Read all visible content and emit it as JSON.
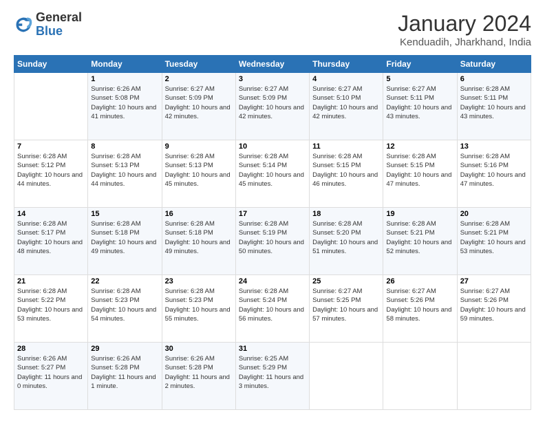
{
  "logo": {
    "line1": "General",
    "line2": "Blue"
  },
  "title": "January 2024",
  "subtitle": "Kenduadih, Jharkhand, India",
  "headers": [
    "Sunday",
    "Monday",
    "Tuesday",
    "Wednesday",
    "Thursday",
    "Friday",
    "Saturday"
  ],
  "weeks": [
    [
      {
        "day": "",
        "sunrise": "",
        "sunset": "",
        "daylight": ""
      },
      {
        "day": "1",
        "sunrise": "Sunrise: 6:26 AM",
        "sunset": "Sunset: 5:08 PM",
        "daylight": "Daylight: 10 hours and 41 minutes."
      },
      {
        "day": "2",
        "sunrise": "Sunrise: 6:27 AM",
        "sunset": "Sunset: 5:09 PM",
        "daylight": "Daylight: 10 hours and 42 minutes."
      },
      {
        "day": "3",
        "sunrise": "Sunrise: 6:27 AM",
        "sunset": "Sunset: 5:09 PM",
        "daylight": "Daylight: 10 hours and 42 minutes."
      },
      {
        "day": "4",
        "sunrise": "Sunrise: 6:27 AM",
        "sunset": "Sunset: 5:10 PM",
        "daylight": "Daylight: 10 hours and 42 minutes."
      },
      {
        "day": "5",
        "sunrise": "Sunrise: 6:27 AM",
        "sunset": "Sunset: 5:11 PM",
        "daylight": "Daylight: 10 hours and 43 minutes."
      },
      {
        "day": "6",
        "sunrise": "Sunrise: 6:28 AM",
        "sunset": "Sunset: 5:11 PM",
        "daylight": "Daylight: 10 hours and 43 minutes."
      }
    ],
    [
      {
        "day": "7",
        "sunrise": "Sunrise: 6:28 AM",
        "sunset": "Sunset: 5:12 PM",
        "daylight": "Daylight: 10 hours and 44 minutes."
      },
      {
        "day": "8",
        "sunrise": "Sunrise: 6:28 AM",
        "sunset": "Sunset: 5:13 PM",
        "daylight": "Daylight: 10 hours and 44 minutes."
      },
      {
        "day": "9",
        "sunrise": "Sunrise: 6:28 AM",
        "sunset": "Sunset: 5:13 PM",
        "daylight": "Daylight: 10 hours and 45 minutes."
      },
      {
        "day": "10",
        "sunrise": "Sunrise: 6:28 AM",
        "sunset": "Sunset: 5:14 PM",
        "daylight": "Daylight: 10 hours and 45 minutes."
      },
      {
        "day": "11",
        "sunrise": "Sunrise: 6:28 AM",
        "sunset": "Sunset: 5:15 PM",
        "daylight": "Daylight: 10 hours and 46 minutes."
      },
      {
        "day": "12",
        "sunrise": "Sunrise: 6:28 AM",
        "sunset": "Sunset: 5:15 PM",
        "daylight": "Daylight: 10 hours and 47 minutes."
      },
      {
        "day": "13",
        "sunrise": "Sunrise: 6:28 AM",
        "sunset": "Sunset: 5:16 PM",
        "daylight": "Daylight: 10 hours and 47 minutes."
      }
    ],
    [
      {
        "day": "14",
        "sunrise": "Sunrise: 6:28 AM",
        "sunset": "Sunset: 5:17 PM",
        "daylight": "Daylight: 10 hours and 48 minutes."
      },
      {
        "day": "15",
        "sunrise": "Sunrise: 6:28 AM",
        "sunset": "Sunset: 5:18 PM",
        "daylight": "Daylight: 10 hours and 49 minutes."
      },
      {
        "day": "16",
        "sunrise": "Sunrise: 6:28 AM",
        "sunset": "Sunset: 5:18 PM",
        "daylight": "Daylight: 10 hours and 49 minutes."
      },
      {
        "day": "17",
        "sunrise": "Sunrise: 6:28 AM",
        "sunset": "Sunset: 5:19 PM",
        "daylight": "Daylight: 10 hours and 50 minutes."
      },
      {
        "day": "18",
        "sunrise": "Sunrise: 6:28 AM",
        "sunset": "Sunset: 5:20 PM",
        "daylight": "Daylight: 10 hours and 51 minutes."
      },
      {
        "day": "19",
        "sunrise": "Sunrise: 6:28 AM",
        "sunset": "Sunset: 5:21 PM",
        "daylight": "Daylight: 10 hours and 52 minutes."
      },
      {
        "day": "20",
        "sunrise": "Sunrise: 6:28 AM",
        "sunset": "Sunset: 5:21 PM",
        "daylight": "Daylight: 10 hours and 53 minutes."
      }
    ],
    [
      {
        "day": "21",
        "sunrise": "Sunrise: 6:28 AM",
        "sunset": "Sunset: 5:22 PM",
        "daylight": "Daylight: 10 hours and 53 minutes."
      },
      {
        "day": "22",
        "sunrise": "Sunrise: 6:28 AM",
        "sunset": "Sunset: 5:23 PM",
        "daylight": "Daylight: 10 hours and 54 minutes."
      },
      {
        "day": "23",
        "sunrise": "Sunrise: 6:28 AM",
        "sunset": "Sunset: 5:23 PM",
        "daylight": "Daylight: 10 hours and 55 minutes."
      },
      {
        "day": "24",
        "sunrise": "Sunrise: 6:28 AM",
        "sunset": "Sunset: 5:24 PM",
        "daylight": "Daylight: 10 hours and 56 minutes."
      },
      {
        "day": "25",
        "sunrise": "Sunrise: 6:27 AM",
        "sunset": "Sunset: 5:25 PM",
        "daylight": "Daylight: 10 hours and 57 minutes."
      },
      {
        "day": "26",
        "sunrise": "Sunrise: 6:27 AM",
        "sunset": "Sunset: 5:26 PM",
        "daylight": "Daylight: 10 hours and 58 minutes."
      },
      {
        "day": "27",
        "sunrise": "Sunrise: 6:27 AM",
        "sunset": "Sunset: 5:26 PM",
        "daylight": "Daylight: 10 hours and 59 minutes."
      }
    ],
    [
      {
        "day": "28",
        "sunrise": "Sunrise: 6:26 AM",
        "sunset": "Sunset: 5:27 PM",
        "daylight": "Daylight: 11 hours and 0 minutes."
      },
      {
        "day": "29",
        "sunrise": "Sunrise: 6:26 AM",
        "sunset": "Sunset: 5:28 PM",
        "daylight": "Daylight: 11 hours and 1 minute."
      },
      {
        "day": "30",
        "sunrise": "Sunrise: 6:26 AM",
        "sunset": "Sunset: 5:28 PM",
        "daylight": "Daylight: 11 hours and 2 minutes."
      },
      {
        "day": "31",
        "sunrise": "Sunrise: 6:25 AM",
        "sunset": "Sunset: 5:29 PM",
        "daylight": "Daylight: 11 hours and 3 minutes."
      },
      {
        "day": "",
        "sunrise": "",
        "sunset": "",
        "daylight": ""
      },
      {
        "day": "",
        "sunrise": "",
        "sunset": "",
        "daylight": ""
      },
      {
        "day": "",
        "sunrise": "",
        "sunset": "",
        "daylight": ""
      }
    ]
  ]
}
